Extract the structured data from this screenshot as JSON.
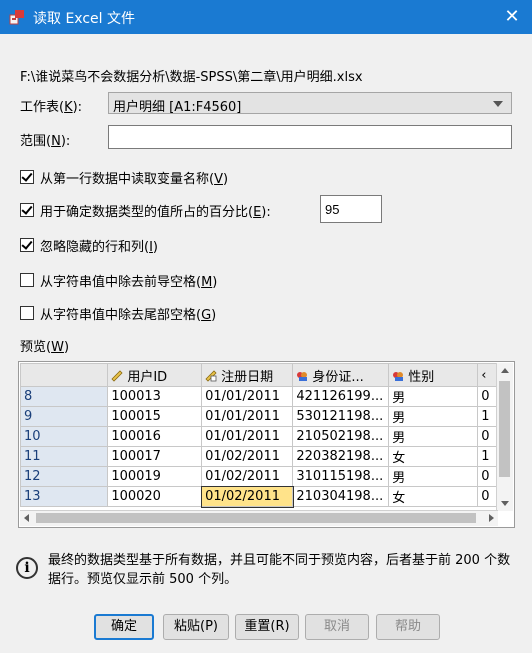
{
  "window": {
    "title": "读取 Excel 文件",
    "close_glyph": "✕"
  },
  "file_path": "F:\\谁说菜鸟不会数据分析\\数据-SPSS\\第二章\\用户明细.xlsx",
  "sheet": {
    "label": "工作表(",
    "key": "K",
    "label_end": "):",
    "value": "用户明细 [A1:F4560]"
  },
  "range": {
    "label": "范围(",
    "key": "N",
    "label_end": "):",
    "value": ""
  },
  "options": [
    {
      "label": "从第一行数据中读取变量名称(",
      "key": "V",
      "end": ")",
      "checked": true
    },
    {
      "label": "用于确定数据类型的值所占的百分比(",
      "key": "E",
      "end": "):",
      "checked": true,
      "value": "95"
    },
    {
      "label": "忽略隐藏的行和列(",
      "key": "I",
      "end": ")",
      "checked": true
    },
    {
      "label": "从字符串值中除去前导空格(",
      "key": "M",
      "end": ")",
      "checked": false
    },
    {
      "label": "从字符串值中除去尾部空格(",
      "key": "G",
      "end": ")",
      "checked": false
    }
  ],
  "preview": {
    "label": "预览(",
    "key": "W",
    "end": ")",
    "columns": [
      "用户ID",
      "注册日期",
      "身份证...",
      "性别",
      "‹"
    ],
    "rows": [
      {
        "num": "8",
        "cells": [
          "100013",
          "01/01/2011",
          "421126199...",
          "男",
          "0"
        ]
      },
      {
        "num": "9",
        "cells": [
          "100015",
          "01/01/2011",
          "530121198...",
          "男",
          "1"
        ]
      },
      {
        "num": "10",
        "cells": [
          "100016",
          "01/01/2011",
          "210502198...",
          "男",
          "0"
        ]
      },
      {
        "num": "11",
        "cells": [
          "100017",
          "01/02/2011",
          "220382198...",
          "女",
          "1"
        ]
      },
      {
        "num": "12",
        "cells": [
          "100019",
          "01/02/2011",
          "310115198...",
          "男",
          "0"
        ]
      },
      {
        "num": "13",
        "cells": [
          "100020",
          "01/02/2011",
          "210304198...",
          "女",
          "0"
        ]
      }
    ]
  },
  "info": "最终的数据类型基于所有数据，并且可能不同于预览内容，后者基于前 200 个数据行。预览仅显示前 500 个列。",
  "buttons": {
    "ok": "确定",
    "paste": "粘贴(P)",
    "reset": "重置(R)",
    "cancel": "取消",
    "help": "帮助"
  },
  "colors": {
    "titlebar": "#1a7ad2",
    "default_button_border": "#1a7ad2",
    "selected_cell": "#ffe38a"
  }
}
